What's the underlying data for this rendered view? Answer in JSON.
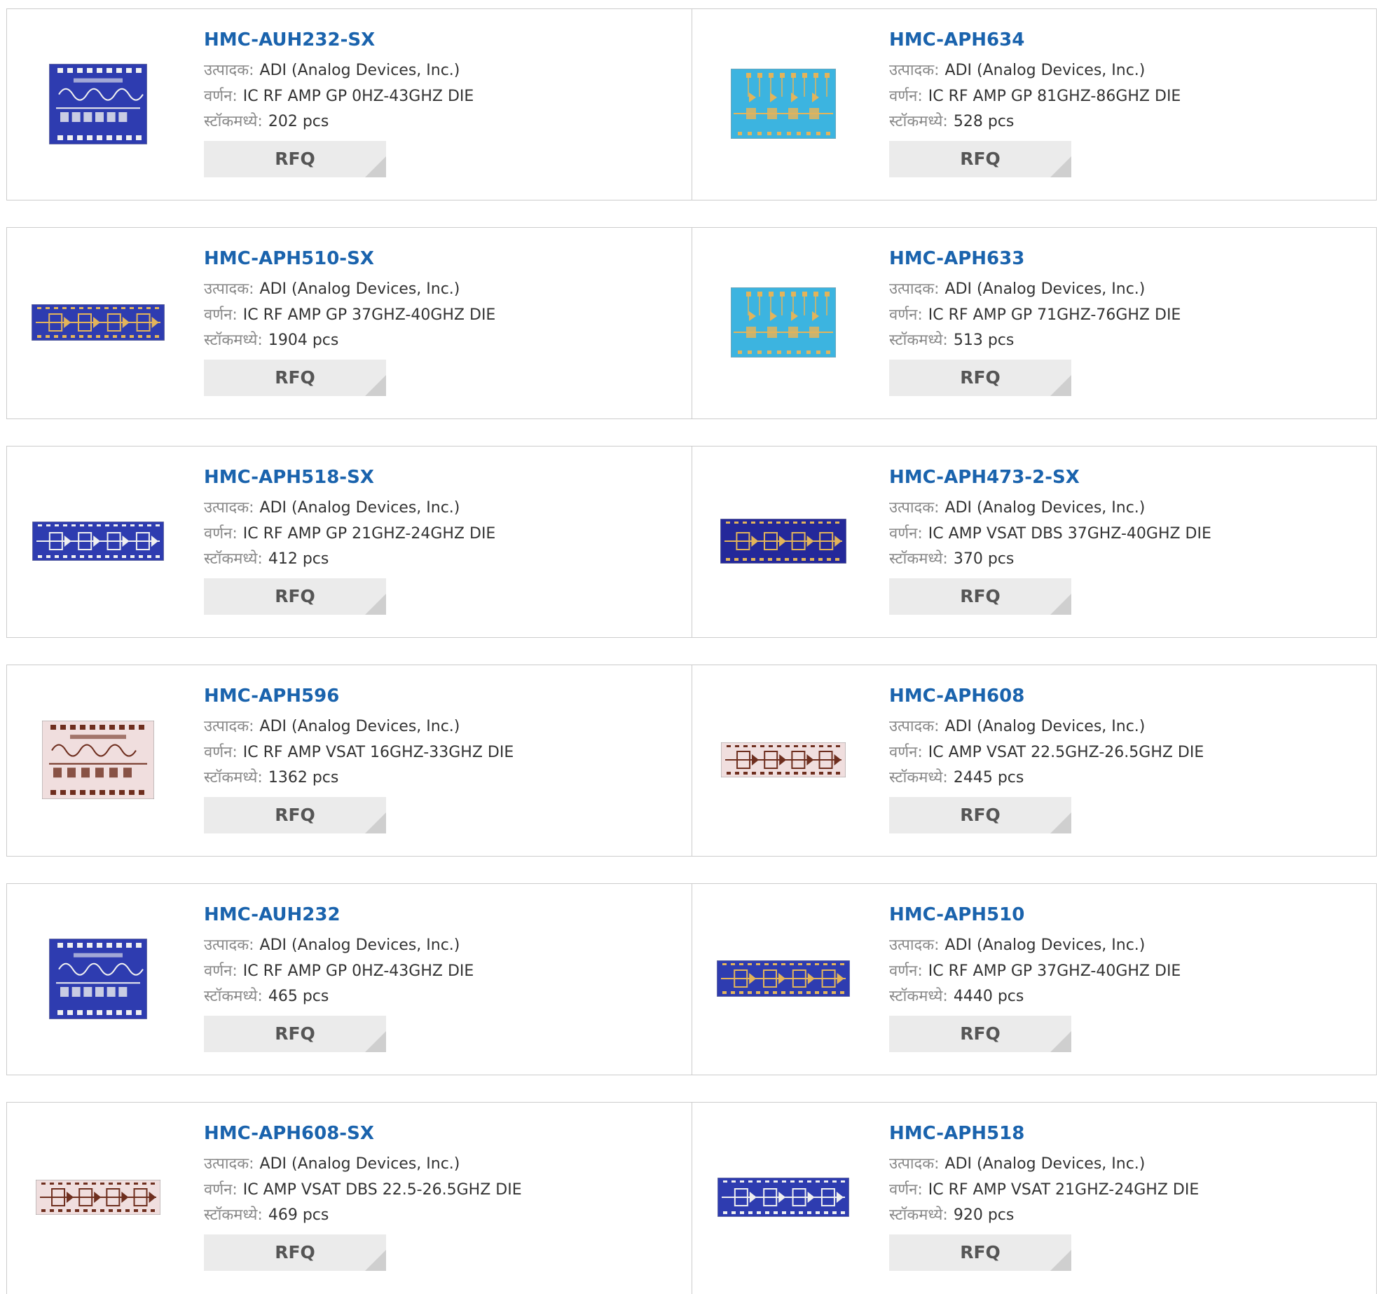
{
  "labels": {
    "manufacturer": "उत्पादक:",
    "description": "वर्णन:",
    "stock": "स्टॉकमध्ये:"
  },
  "rfq_label": "RFQ",
  "chip_colors": {
    "blue": "#2e3cb0",
    "navy": "#24289a",
    "cyan": "#3cb4e0",
    "pink": "#f0dede",
    "pad": "#e3b45a",
    "trace": "#f0f0f0",
    "dark": "#6e2e1e"
  },
  "products": [
    {
      "part": "HMC-AUH232-SX",
      "manufacturer": "ADI (Analog Devices, Inc.)",
      "description": "IC RF AMP GP 0HZ-43GHZ DIE",
      "stock": "202 pcs",
      "chip": "blue-square"
    },
    {
      "part": "HMC-APH634",
      "manufacturer": "ADI (Analog Devices, Inc.)",
      "description": "IC RF AMP GP 81GHZ-86GHZ DIE",
      "stock": "528 pcs",
      "chip": "cyan"
    },
    {
      "part": "HMC-APH510-SX",
      "manufacturer": "ADI (Analog Devices, Inc.)",
      "description": "IC RF AMP GP 37GHZ-40GHZ DIE",
      "stock": "1904 pcs",
      "chip": "blue-strip"
    },
    {
      "part": "HMC-APH633",
      "manufacturer": "ADI (Analog Devices, Inc.)",
      "description": "IC RF AMP GP 71GHZ-76GHZ DIE",
      "stock": "513 pcs",
      "chip": "cyan"
    },
    {
      "part": "HMC-APH518-SX",
      "manufacturer": "ADI (Analog Devices, Inc.)",
      "description": "IC RF AMP GP 21GHZ-24GHZ DIE",
      "stock": "412 pcs",
      "chip": "blue-wide"
    },
    {
      "part": "HMC-APH473-2-SX",
      "manufacturer": "ADI (Analog Devices, Inc.)",
      "description": "IC AMP VSAT DBS 37GHZ-40GHZ DIE",
      "stock": "370 pcs",
      "chip": "navy-gold"
    },
    {
      "part": "HMC-APH596",
      "manufacturer": "ADI (Analog Devices, Inc.)",
      "description": "IC RF AMP VSAT 16GHZ-33GHZ DIE",
      "stock": "1362 pcs",
      "chip": "pink-square"
    },
    {
      "part": "HMC-APH608",
      "manufacturer": "ADI (Analog Devices, Inc.)",
      "description": "IC AMP VSAT 22.5GHZ-26.5GHZ DIE",
      "stock": "2445 pcs",
      "chip": "pink-strip"
    },
    {
      "part": "HMC-AUH232",
      "manufacturer": "ADI (Analog Devices, Inc.)",
      "description": "IC RF AMP GP 0HZ-43GHZ DIE",
      "stock": "465 pcs",
      "chip": "blue-square"
    },
    {
      "part": "HMC-APH510",
      "manufacturer": "ADI (Analog Devices, Inc.)",
      "description": "IC RF AMP GP 37GHZ-40GHZ DIE",
      "stock": "4440 pcs",
      "chip": "blue-strip"
    },
    {
      "part": "HMC-APH608-SX",
      "manufacturer": "ADI (Analog Devices, Inc.)",
      "description": "IC AMP VSAT DBS 22.5-26.5GHZ DIE",
      "stock": "469 pcs",
      "chip": "pink-strip"
    },
    {
      "part": "HMC-APH518",
      "manufacturer": "ADI (Analog Devices, Inc.)",
      "description": "IC RF AMP VSAT 21GHZ-24GHZ DIE",
      "stock": "920 pcs",
      "chip": "blue-wide"
    }
  ]
}
